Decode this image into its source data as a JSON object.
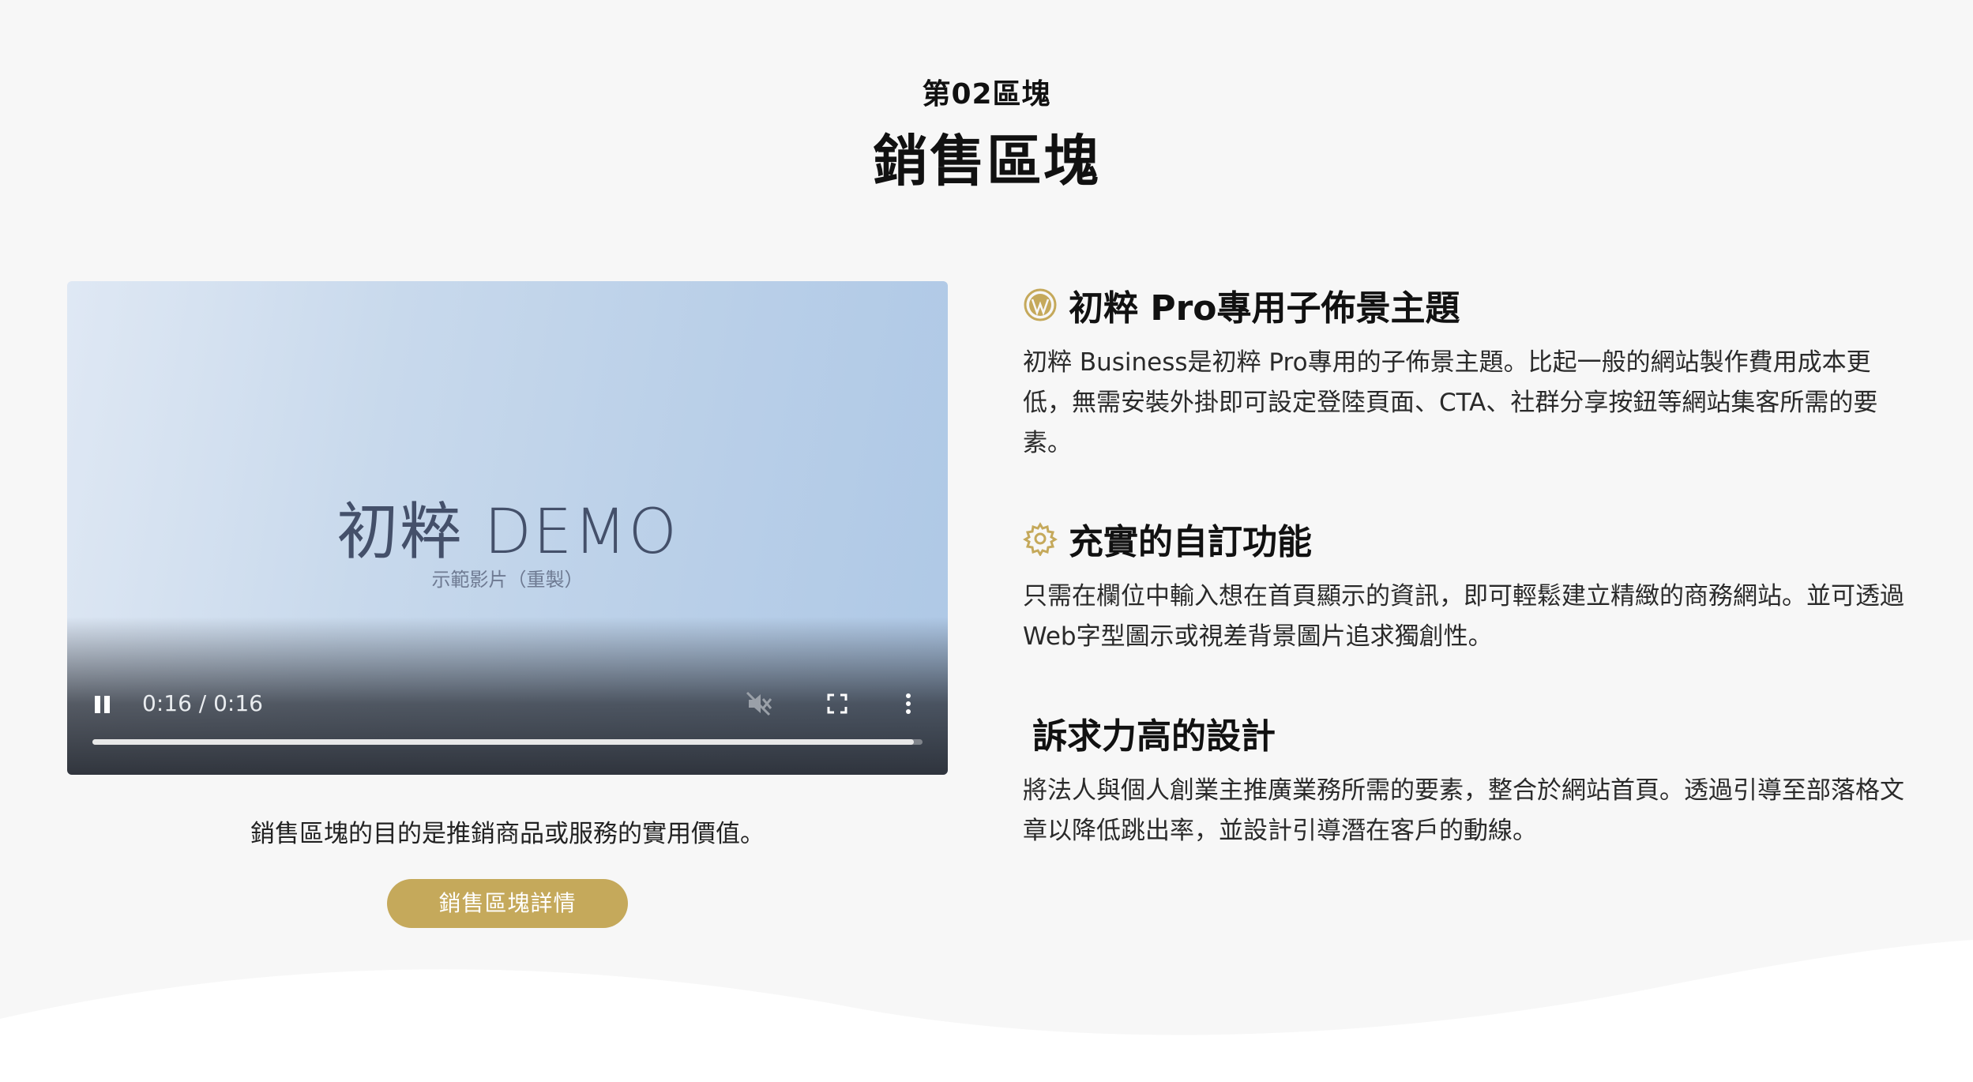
{
  "header": {
    "eyebrow": "第02區塊",
    "title": "銷售區塊"
  },
  "video": {
    "title": "初粹 DEMO",
    "subtitle": "示範影片（重製）",
    "time": "0:16 / 0:16",
    "progress_fraction": 0.99
  },
  "left": {
    "caption": "銷售區塊的目的是推銷商品或服務的實用價值。",
    "button_label": "銷售區塊詳情"
  },
  "features": [
    {
      "icon": "wordpress-icon",
      "title": "初粹 Pro專用子佈景主題",
      "text": "初粹 Business是初粹 Pro專用的子佈景主題。比起一般的網站製作費用成本更低，無需安裝外掛即可設定登陸頁面、CTA、社群分享按鈕等網站集客所需的要素。"
    },
    {
      "icon": "gear-icon",
      "title": "充實的自訂功能",
      "text": "只需在欄位中輸入想在首頁顯示的資訊，即可輕鬆建立精緻的商務網站。並可透過Web字型圖示或視差背景圖片追求獨創性。"
    },
    {
      "icon": "",
      "title": "訴求力高的設計",
      "text": "將法人與個人創業主推廣業務所需的要素，整合於網站首頁。透過引導至部落格文章以降低跳出率，並設計引導潛在客戶的動線。"
    }
  ],
  "colors": {
    "accent": "#c5a95b",
    "background": "#f7f7f7"
  }
}
